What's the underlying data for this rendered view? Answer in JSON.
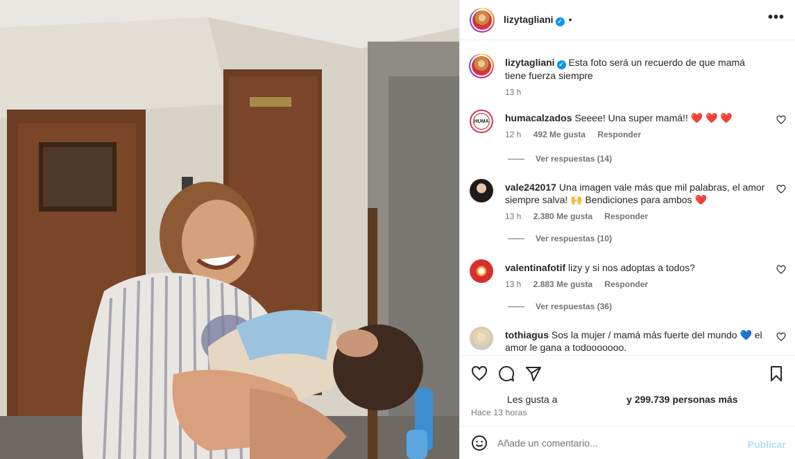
{
  "post": {
    "author": "lizytagliani",
    "separator": "•",
    "caption": "Esta foto será un recuerdo de que mamá tiene fuerza siempre",
    "caption_time": "13 h"
  },
  "comments": [
    {
      "username": "humacalzados",
      "text": "Seeee! Una super mamá!!",
      "emoji": "❤️ ❤️ ❤️",
      "time": "12 h",
      "likes": "492 Me gusta",
      "reply_label": "Responder",
      "view_replies": "Ver respuestas (14)",
      "avatar_text": "HUMA"
    },
    {
      "username": "vale242017",
      "text": "Una imagen vale más que mil palabras, el amor siempre salva! 🙌 Bendiciones para ambos",
      "emoji": "❤️",
      "time": "13 h",
      "likes": "2.380 Me gusta",
      "reply_label": "Responder",
      "view_replies": "Ver respuestas (10)"
    },
    {
      "username": "valentinafotif",
      "text": "lizy y si nos adoptas a todos?",
      "emoji": "",
      "time": "13 h",
      "likes": "2.883 Me gusta",
      "reply_label": "Responder",
      "view_replies": "Ver respuestas (36)"
    },
    {
      "username": "tothiagus",
      "text": "Sos la mujer / mamá más fuerte del mundo 💙 el amor le gana a todooooooo.",
      "emoji": ""
    }
  ],
  "footer": {
    "likes_prefix": "Les gusta a",
    "likes_suffix": "y 299.739 personas más",
    "time_ago": "Hace 13 horas",
    "comment_placeholder": "Añade un comentario...",
    "publish_label": "Publicar"
  },
  "icons": {
    "more": "more-options-icon",
    "like": "heart-icon",
    "comment": "comment-icon",
    "share": "share-icon",
    "save": "bookmark-icon",
    "emoji": "emoji-icon",
    "verified": "verified-badge-icon"
  },
  "colors": {
    "verified": "#0095f6",
    "heart": "#ed4956",
    "publish_disabled": "#b3dbff",
    "secondary_text": "#737373"
  }
}
